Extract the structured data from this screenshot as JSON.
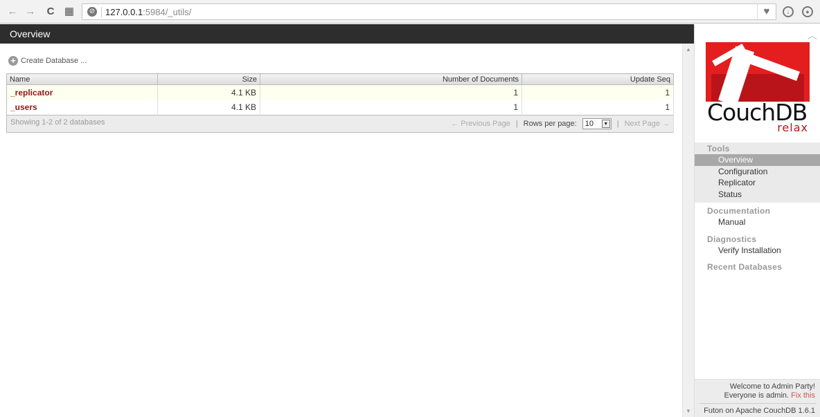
{
  "browser": {
    "url_host": "127.0.0.1",
    "url_rest": ":5984/_utils/",
    "icons": {
      "back": "←",
      "forward": "→",
      "reload": "C",
      "apps": "▦",
      "site_info": "⊘",
      "bookmark": "♥",
      "download": "⬇",
      "account": "👤"
    }
  },
  "main": {
    "title": "Overview",
    "create_database_label": "Create Database ...",
    "table": {
      "columns": [
        "Name",
        "Size",
        "Number of Documents",
        "Update Seq"
      ],
      "rows": [
        {
          "name": "_replicator",
          "size": "4.1 KB",
          "docs": "1",
          "seq": "1"
        },
        {
          "name": "_users",
          "size": "4.1 KB",
          "docs": "1",
          "seq": "1"
        }
      ],
      "footer": {
        "showing": "Showing 1-2 of 2 databases",
        "previous_page": "← Previous Page",
        "separator": "|",
        "rows_per_page_label": "Rows per page:",
        "rows_per_page_value": "10",
        "next_page": "Next Page →"
      }
    }
  },
  "sidebar": {
    "logo": {
      "wordmark": "CouchDB",
      "tagline": "relax"
    },
    "sections": [
      {
        "title": "Tools",
        "items": [
          "Overview",
          "Configuration",
          "Replicator",
          "Status"
        ]
      },
      {
        "title": "Documentation",
        "items": [
          "Manual"
        ]
      },
      {
        "title": "Diagnostics",
        "items": [
          "Verify Installation"
        ]
      },
      {
        "title": "Recent Databases",
        "items": []
      }
    ],
    "active_item": "Overview",
    "footer": {
      "welcome_line1": "Welcome to Admin Party!",
      "welcome_line2": "Everyone is admin.",
      "fix_link": "Fix this",
      "version": "Futon on Apache CouchDB 1.6.1"
    }
  }
}
